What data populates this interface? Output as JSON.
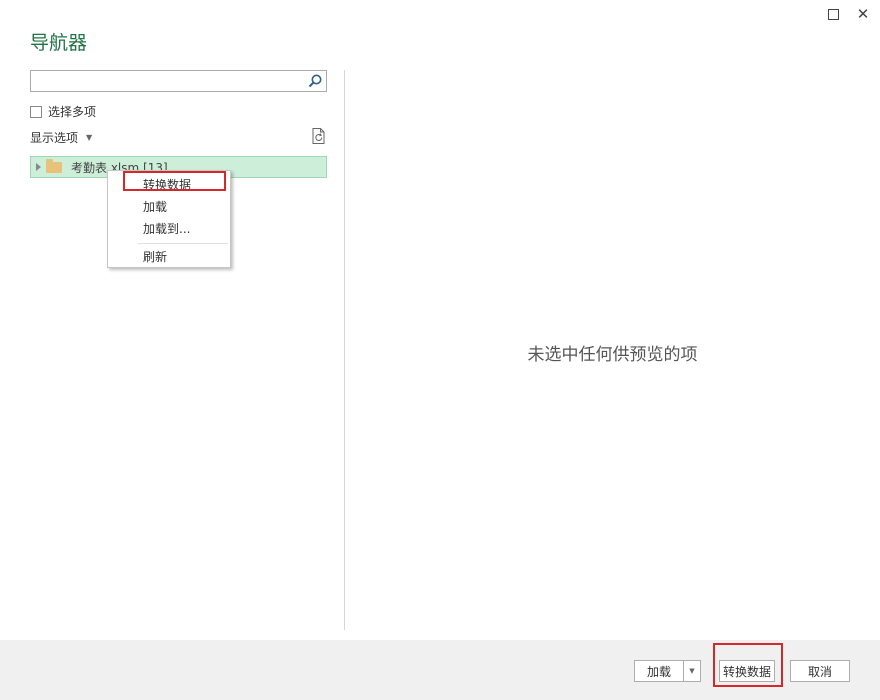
{
  "window": {
    "title": "导航器",
    "maximize_icon": "maximize-icon",
    "close_icon": "close-icon",
    "close_glyph": "✕"
  },
  "left_panel": {
    "search": {
      "value": "",
      "placeholder": "",
      "icon": "search-icon"
    },
    "select_multiple": {
      "label": "选择多项",
      "checked": false
    },
    "display_options": {
      "label": "显示选项",
      "caret": "▼"
    },
    "refresh_icon": "refresh-document-icon",
    "tree": [
      {
        "label": "考勤表.xlsm [13]",
        "expanded": false,
        "selected": true,
        "icon": "folder-icon"
      }
    ]
  },
  "context_menu": {
    "items": [
      {
        "label": "转换数据",
        "highlighted": true
      },
      {
        "label": "加载"
      },
      {
        "label": "加载到..."
      },
      {
        "label": "刷新"
      }
    ]
  },
  "preview": {
    "empty_message": "未选中任何供预览的项"
  },
  "footer": {
    "load_label": "加载",
    "load_dropdown_glyph": "▼",
    "transform_label": "转换数据",
    "cancel_label": "取消"
  },
  "colors": {
    "title": "#217346",
    "selected_row": "#cdeed9",
    "highlight_box": "#d5282b",
    "footer_bg": "#f0f0f0"
  }
}
